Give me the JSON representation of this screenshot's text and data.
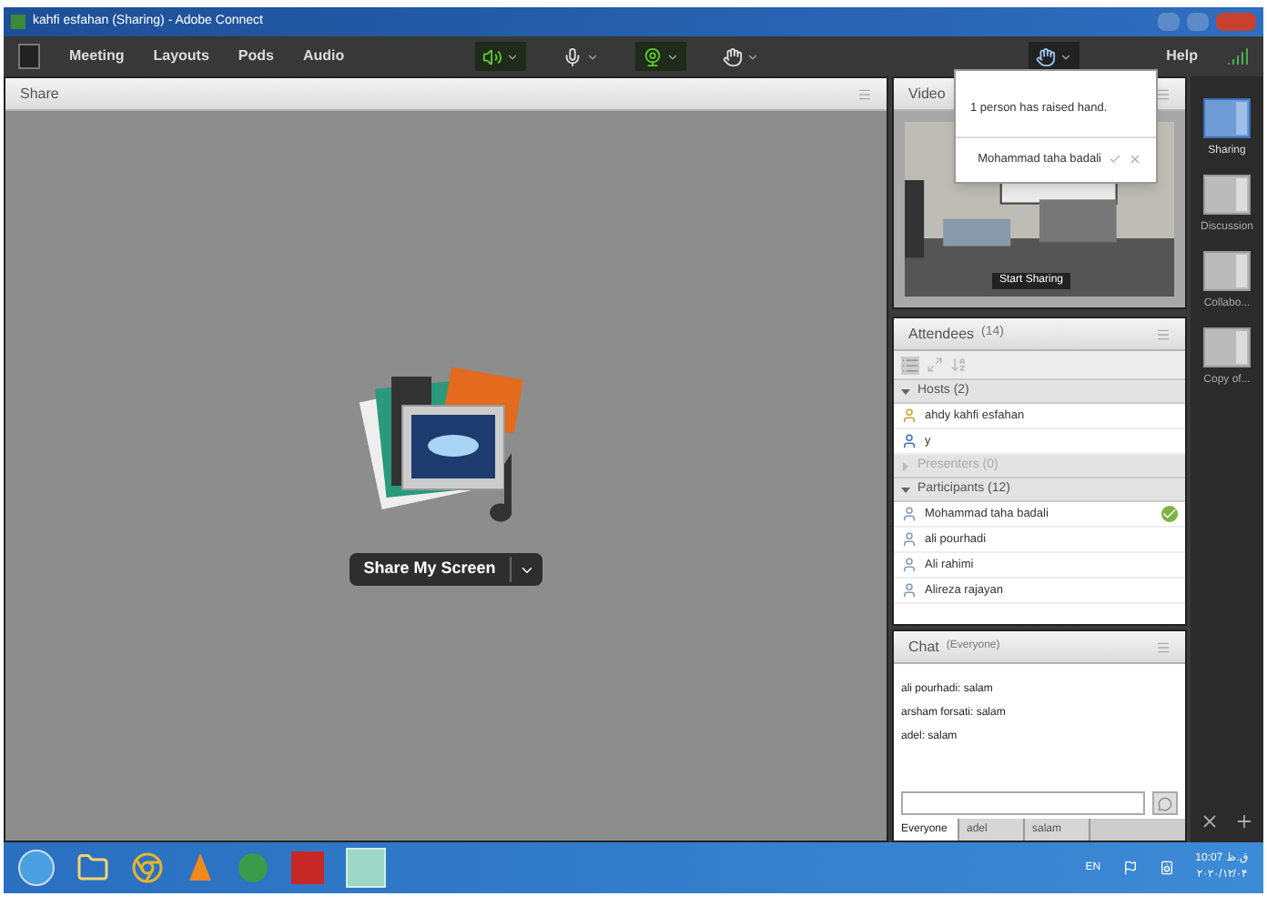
{
  "window": {
    "title": "kahfi esfahan (Sharing) - Adobe Connect"
  },
  "menu": [
    "Meeting",
    "Layouts",
    "Pods",
    "Audio"
  ],
  "devices": [
    {
      "kind": "speaker",
      "on": true
    },
    {
      "kind": "mic",
      "on": false
    },
    {
      "kind": "camera",
      "on": true
    },
    {
      "kind": "hand",
      "on": false
    }
  ],
  "help": "Help",
  "share_pod": {
    "title": "Share",
    "button": "Share My Screen"
  },
  "video_pod": {
    "title": "Video",
    "button": "Start Sharing"
  },
  "notification": {
    "message": "1 person has raised hand.",
    "name": "Mohammad taha badali"
  },
  "attendees": {
    "title": "Attendees",
    "count": "(14)",
    "groups": [
      {
        "label": "Hosts (2)",
        "expanded": true,
        "children": [
          {
            "name": "ahdy kahfi esfahan",
            "kind": "host",
            "agreed": false
          },
          {
            "name": "y",
            "kind": "presenter",
            "agreed": false
          }
        ]
      },
      {
        "label": "Presenters (0)",
        "expanded": false
      },
      {
        "label": "Participants (12)",
        "expanded": true,
        "children": [
          {
            "name": "Mohammad taha badali",
            "kind": "participant",
            "agreed": true
          },
          {
            "name": "ali pourhadi",
            "kind": "participant",
            "agreed": false
          },
          {
            "name": "Ali rahimi",
            "kind": "participant",
            "agreed": false
          },
          {
            "name": "Alireza rajayan",
            "kind": "participant",
            "agreed": false
          }
        ]
      }
    ]
  },
  "chat": {
    "title": "Chat",
    "scope": "(Everyone)",
    "messages": [
      "ali pourhadi: salam",
      "arsham forsati: salam",
      "adel: salam"
    ],
    "tabs": [
      {
        "label": "Everyone",
        "selected": true
      },
      {
        "label": "adel",
        "selected": false
      },
      {
        "label": "salam",
        "selected": false
      }
    ]
  },
  "layouts": [
    {
      "label": "Sharing",
      "selected": true
    },
    {
      "label": "Discussion",
      "selected": false
    },
    {
      "label": "Collabo...",
      "selected": false
    },
    {
      "label": "Copy of...",
      "selected": false
    }
  ],
  "taskbar": {
    "language": "EN",
    "time": "10:07 ق.ظ",
    "date": "۲۰۲۰/۱۲/۰۴"
  }
}
